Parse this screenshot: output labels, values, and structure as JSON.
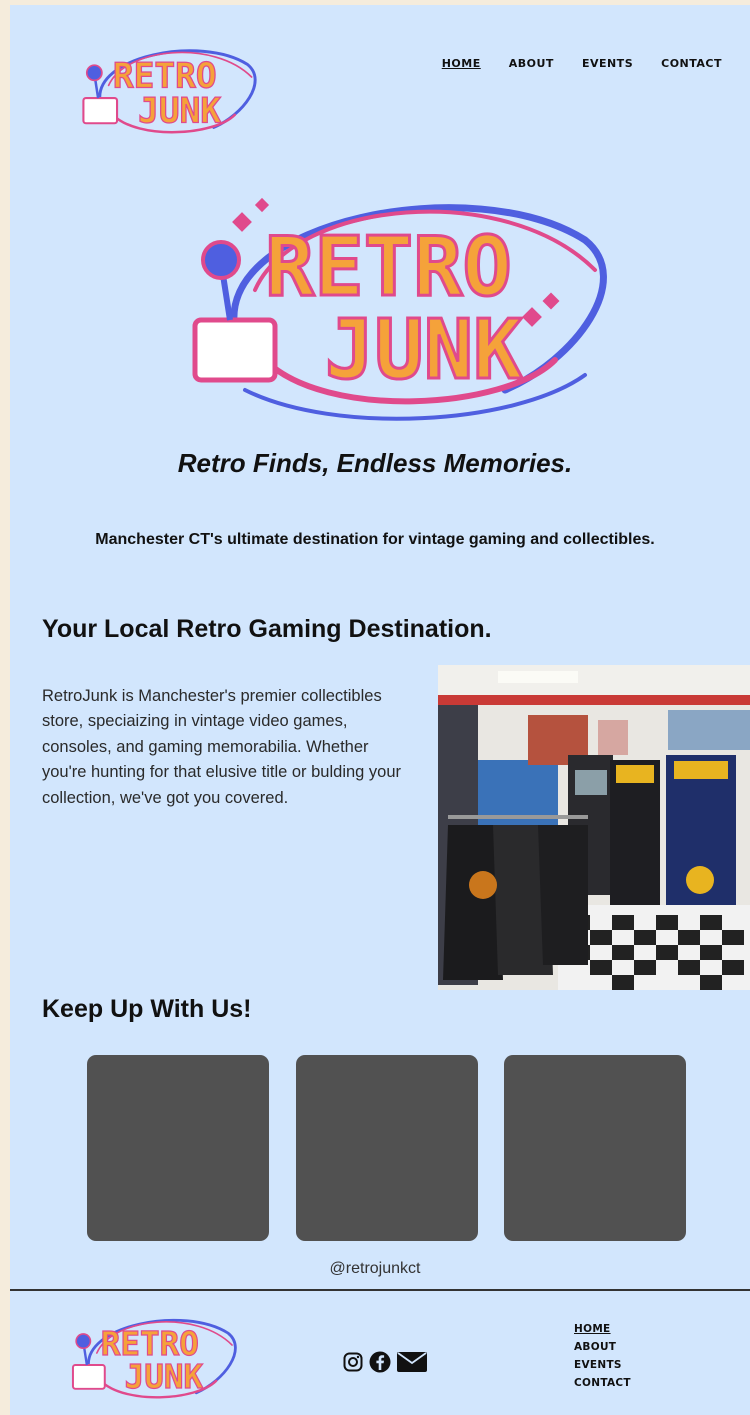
{
  "brand": {
    "logo_line1": "RETRO",
    "logo_line2": "JUNK",
    "colors": {
      "background": "#d2e6fd",
      "logo_orange": "#f5a23a",
      "logo_pink": "#e04a8c",
      "logo_blue": "#4f5fe0",
      "tile": "#515151"
    }
  },
  "nav": {
    "items": [
      {
        "label": "HOME",
        "active": true
      },
      {
        "label": "ABOUT",
        "active": false
      },
      {
        "label": "EVENTS",
        "active": false
      },
      {
        "label": "CONTACT",
        "active": false
      }
    ]
  },
  "hero": {
    "tagline": "Retro Finds, Endless Memories.",
    "subtagline": "Manchester CT's ultimate destination for vintage gaming and collectibles."
  },
  "about": {
    "title": "Your Local Retro Gaming Destination.",
    "body": "RetroJunk is Manchester's premier collectibles store, speciaizing in vintage video games, consoles, and gaming memorabilia. Whether you're hunting for that elusive title or bulding your collection, we've got you covered."
  },
  "social_feed": {
    "title": "Keep Up With Us!",
    "handle": "@retrojunkct",
    "tile_count": 3
  },
  "footer": {
    "icons": [
      "instagram-icon",
      "facebook-icon",
      "mail-icon"
    ],
    "nav": [
      {
        "label": "HOME",
        "active": true
      },
      {
        "label": "ABOUT",
        "active": false
      },
      {
        "label": "EVENTS",
        "active": false
      },
      {
        "label": "CONTACT",
        "active": false
      }
    ]
  }
}
